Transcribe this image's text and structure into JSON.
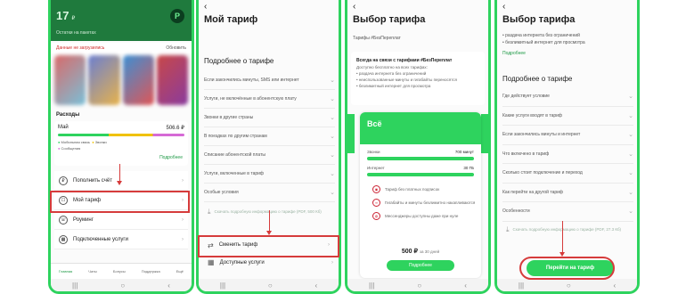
{
  "phone1": {
    "balance": "17",
    "balance_unit": "₽",
    "avatar": "P",
    "subtitle": "Остатки на пакетах",
    "update_warning": "Данные не загрузились",
    "update_button": "Обновить",
    "expenses_title": "Расходы",
    "expenses_month": "Май",
    "expenses_amount": "506.6 ₽",
    "legend": [
      "Мобильная связь",
      "Звонки",
      "Сообщения"
    ],
    "expenses_more": "Подробнее",
    "menu": [
      {
        "icon": "₽",
        "label": "Пополнить счёт"
      },
      {
        "icon": "☐",
        "label": "Мой тариф"
      },
      {
        "icon": "☏",
        "label": "Роуминг"
      },
      {
        "icon": "▦",
        "label": "Подключенные услуги"
      }
    ],
    "tabs": [
      "Главная",
      "Чаты",
      "Бонусы",
      "Поддержка",
      "Ещё"
    ]
  },
  "phone2": {
    "title": "Мой тариф",
    "section": "Подробнее о тарифе",
    "rows": [
      "Если закончились минуты, SMS или интернет",
      "Услуги, не включённые в абонентскую плату",
      "Звонки в другие страны",
      "В поездках по другим странам",
      "Списание абонентской платы",
      "Услуги, включенные в тариф",
      "Особые условия"
    ],
    "download": "Скачать подробную информацию о тарифе (PDF, 500 Кб)",
    "change_tariff": "Сменить тариф",
    "available_services": "Доступные услуги"
  },
  "phone3": {
    "title": "Выбор тарифа",
    "crumb": "Тарифы #БезПереплат",
    "promo_title": "Всегда на связи с тарифами #БезПереплат",
    "promo_lines": [
      "Доступно бесплатно на всех тарифах:",
      "• раздача интернета без ограничений",
      "• неиспользованные минуты и гигабайты переносятся",
      "• безлимитный интернет для просмотра"
    ],
    "card_name": "Всё",
    "limits": [
      {
        "label": "Звонки",
        "value": "700 минут"
      },
      {
        "label": "Интернет",
        "value": "30 ГБ"
      }
    ],
    "features": [
      "Тариф без платных подписок",
      "Гигабайты и минуты безлимитно накапливаются",
      "Мессенджеры доступны даже при нуле"
    ],
    "price": "500 ₽",
    "price_period": "за 30 дней",
    "card_button": "Подробнее"
  },
  "phone4": {
    "title": "Выбор тарифа",
    "top_lines": [
      "• раздача интернета без ограничений",
      "• безлимитный интернет для просмотра"
    ],
    "more": "Подробнее",
    "section": "Подробнее о тарифе",
    "rows": [
      "Где действует условие",
      "Какие услуги входят в тариф",
      "Если закончились минуты и интернет",
      "Что включено в тариф",
      "Сколько стоит подключение и переход",
      "Как перейти на другой тариф",
      "Особенности"
    ],
    "download": "Скачать подробную информацию о тарифе (PDF, 27.3 Кб)",
    "button": "Перейти на тариф"
  },
  "colors": {
    "accent": "#2ed35e",
    "header": "#1f7a3d",
    "annotation": "#d63b3b"
  }
}
